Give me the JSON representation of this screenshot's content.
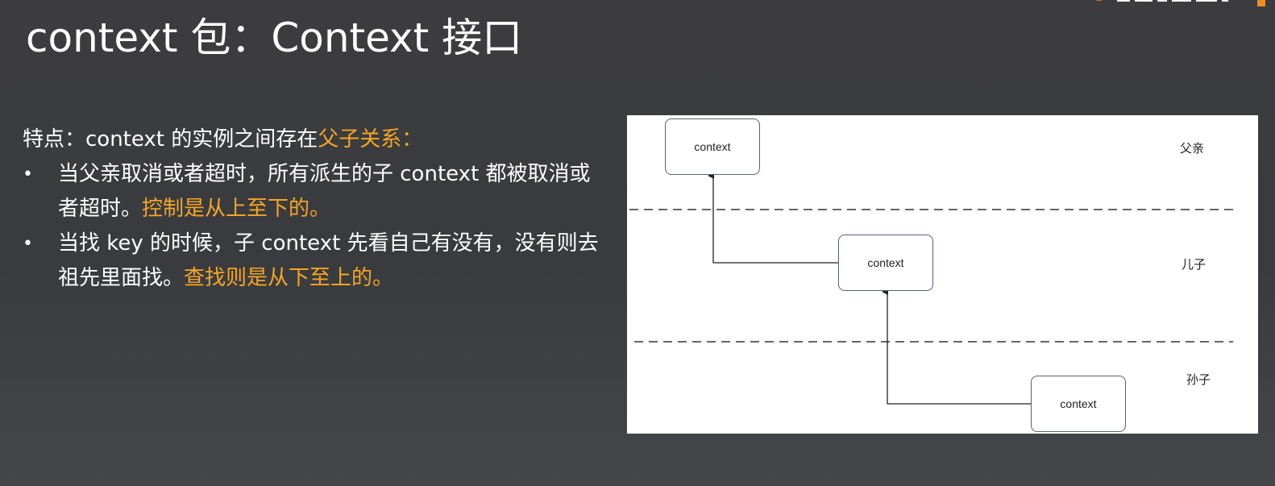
{
  "slide": {
    "title": "context 包：Context 接口",
    "lead": {
      "text": "特点：context 的实例之间存在",
      "highlight": "父子关系："
    },
    "bullets": [
      {
        "bullet": "•",
        "text": "当父亲取消或者超时，所有派生的子 context 都被取消或者超时。",
        "highlight": "控制是从上至下的。"
      },
      {
        "bullet": "•",
        "text": "当找 key 的时候，子 context 先看自己有没有，没有则去祖先里面找。",
        "highlight": "查找则是从下至上的。"
      }
    ]
  },
  "diagram": {
    "boxes": [
      {
        "label": "context"
      },
      {
        "label": "context"
      },
      {
        "label": "context"
      }
    ],
    "levels": [
      {
        "label": "父亲"
      },
      {
        "label": "儿子"
      },
      {
        "label": "孙子"
      }
    ]
  },
  "colors": {
    "highlight": "#f5a623",
    "text": "#ffffff",
    "background": "#3c3c3f",
    "box_border": "#5a5f7a"
  }
}
